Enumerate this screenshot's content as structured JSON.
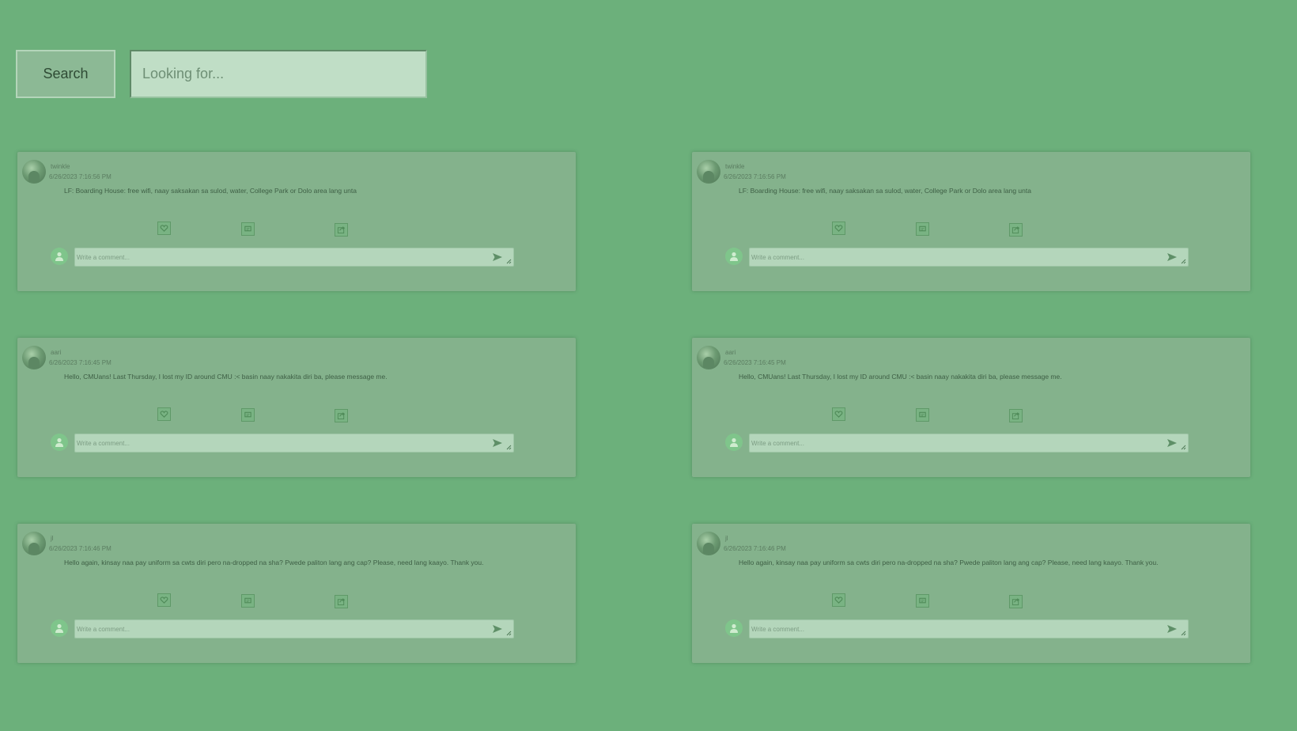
{
  "search": {
    "button_label": "Search",
    "placeholder": "Looking for..."
  },
  "icons": {
    "like": "heart-icon",
    "comment": "comment-icon",
    "share": "share-icon",
    "send": "send-icon"
  },
  "colors": {
    "background": "#6cb07b",
    "card": "#84b28c",
    "input": "#c0dec6"
  },
  "comment_placeholder": "Write a comment...",
  "posts": [
    {
      "user": "twinkle",
      "timestamp": "6/26/2023 7:16:56 PM",
      "content": "LF: Boarding House: free wifi, naay saksakan sa sulod, water, College Park or Dolo area lang unta"
    },
    {
      "user": "aari",
      "timestamp": "6/26/2023 7:16:45 PM",
      "content": "Hello, CMUans! Last Thursday, I lost my ID around CMU :< basin naay nakakita diri ba, please message me."
    },
    {
      "user": "jl",
      "timestamp": "6/26/2023 7:16:46 PM",
      "content": "Hello again, kinsay naa pay uniform sa cwts diri pero na-dropped na sha? Pwede paliton lang ang cap? Please, need lang kaayo. Thank you."
    },
    {
      "user": "twinkle",
      "timestamp": "6/26/2023 7:16:56 PM",
      "content": "LF: Boarding House: free wifi, naay saksakan sa sulod, water, College Park or Dolo area lang unta"
    },
    {
      "user": "aari",
      "timestamp": "6/26/2023 7:16:45 PM",
      "content": "Hello, CMUans! Last Thursday, I lost my ID around CMU :< basin naay nakakita diri ba, please message me."
    },
    {
      "user": "jl",
      "timestamp": "6/26/2023 7:16:46 PM",
      "content": "Hello again, kinsay naa pay uniform sa cwts diri pero na-dropped na sha? Pwede paliton lang ang cap? Please, need lang kaayo. Thank you."
    }
  ]
}
